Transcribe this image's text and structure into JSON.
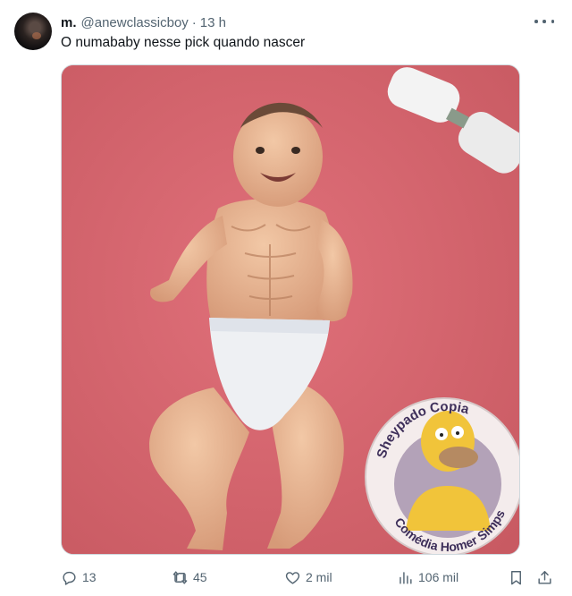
{
  "tweet": {
    "author": {
      "name": "m.",
      "handle": "@anewclassicboy",
      "separator": "·",
      "time": "13 h"
    },
    "text": "O numababy nesse pick quando nascer",
    "media": {
      "sticker_top_text": "Sheypado Copia",
      "sticker_bottom_text": "Comédia Homer Simpson"
    },
    "actions": {
      "replies": "13",
      "reposts": "45",
      "likes": "2 mil",
      "views": "106 mil"
    },
    "icons": [
      "more-icon",
      "reply-icon",
      "repost-icon",
      "like-icon",
      "views-icon",
      "bookmark-icon",
      "share-icon"
    ],
    "colors": {
      "text": "#0f1419",
      "muted": "#536471",
      "border": "#cfd9de",
      "blanket": "#d8656b"
    }
  }
}
